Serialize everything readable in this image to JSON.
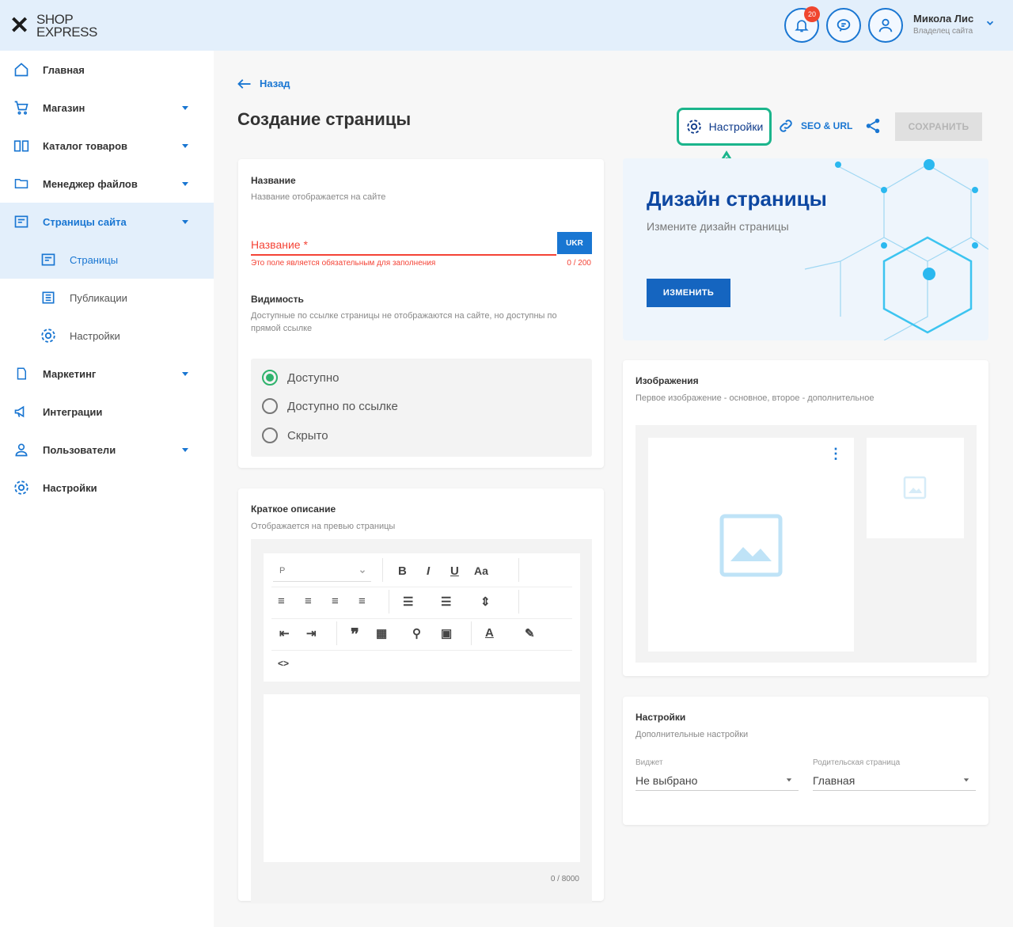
{
  "header": {
    "logo_line1": "SHOP",
    "logo_line2": "EXPRESS",
    "notification_count": "20",
    "user_name": "Микола Лис",
    "user_role": "Владелец сайта"
  },
  "sidebar": {
    "items": [
      {
        "label": "Главная",
        "icon": "home-icon"
      },
      {
        "label": "Магазин",
        "icon": "cart-icon"
      },
      {
        "label": "Каталог товаров",
        "icon": "book-icon"
      },
      {
        "label": "Менеджер файлов",
        "icon": "folder-icon"
      },
      {
        "label": "Страницы сайта",
        "icon": "pages-icon"
      },
      {
        "label": "Маркетинг",
        "icon": "tag-icon"
      },
      {
        "label": "Интеграции",
        "icon": "megaphone-icon"
      },
      {
        "label": "Пользователи",
        "icon": "user-icon"
      },
      {
        "label": "Настройки",
        "icon": "gear-icon"
      }
    ],
    "subitems": [
      {
        "label": "Страницы",
        "icon": "page-icon"
      },
      {
        "label": "Публикации",
        "icon": "news-icon"
      },
      {
        "label": "Настройки",
        "icon": "gear-icon"
      }
    ]
  },
  "main": {
    "back_label": "Назад",
    "title": "Создание страницы",
    "actions": {
      "settings": "Настройки",
      "seo": "SEO & URL",
      "save": "СОХРАНИТЬ"
    }
  },
  "name_card": {
    "title": "Название",
    "subtitle": "Название отображается на сайте",
    "field_label": "Название *",
    "lang": "UKR",
    "error": "Это поле является обязательным для заполнения",
    "counter": "0 / 200",
    "visibility_title": "Видимость",
    "visibility_subtitle": "Доступные по ссылке страницы не отображаются на сайте, но доступны по прямой ссылке",
    "options": [
      "Доступно",
      "Доступно по ссылке",
      "Скрыто"
    ],
    "selected_option": "Доступно"
  },
  "description_card": {
    "title": "Краткое описание",
    "subtitle": "Отображается на превью страницы",
    "format_select": "P",
    "font_size_label": "Aa",
    "counter": "0 / 8000"
  },
  "design_card": {
    "title": "Дизайн страницы",
    "subtitle": "Измените дизайн страницы",
    "button": "ИЗМЕНИТЬ"
  },
  "images_card": {
    "title": "Изображения",
    "subtitle": "Первое изображение - основное, второе - дополнительное"
  },
  "settings_card": {
    "title": "Настройки",
    "subtitle": "Дополнительные настройки",
    "widget_label": "Виджет",
    "widget_value": "Не выбрано",
    "parent_label": "Родительская страница",
    "parent_value": "Главная"
  },
  "colors": {
    "accent": "#1976d2",
    "highlight": "#1bb58c",
    "error": "#f44336"
  }
}
